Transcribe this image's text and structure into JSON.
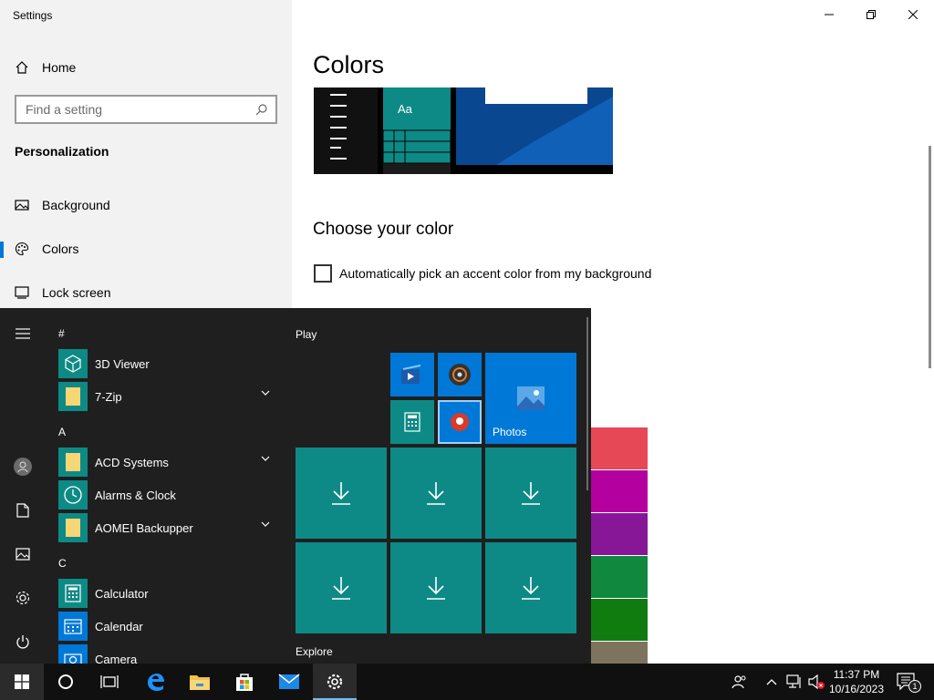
{
  "window": {
    "title": "Settings"
  },
  "sidebar": {
    "home_label": "Home",
    "search_placeholder": "Find a setting",
    "section_title": "Personalization",
    "items": [
      {
        "label": "Background",
        "icon": "image-icon"
      },
      {
        "label": "Colors",
        "icon": "palette-icon",
        "active": true
      },
      {
        "label": "Lock screen",
        "icon": "lock-screen-icon"
      }
    ]
  },
  "main": {
    "title": "Colors",
    "preview_tile_text": "Aa",
    "choose_title": "Choose your color",
    "auto_pick_label": "Automatically pick an accent color from my background",
    "auto_pick_checked": false
  },
  "swatch_colors": [
    "#e74856",
    "#b4009e",
    "#881798",
    "#10893e",
    "#107c10",
    "#7e735f"
  ],
  "start_menu": {
    "sections": [
      {
        "header": "#",
        "apps": [
          {
            "name": "3D Viewer",
            "icon": "cube-icon"
          },
          {
            "name": "7-Zip",
            "icon": "folder-icon",
            "expandable": true
          }
        ]
      },
      {
        "header": "A",
        "apps": [
          {
            "name": "ACD Systems",
            "icon": "folder-icon",
            "expandable": true
          },
          {
            "name": "Alarms & Clock",
            "icon": "clock-icon"
          },
          {
            "name": "AOMEI Backupper",
            "icon": "folder-icon",
            "expandable": true
          }
        ]
      },
      {
        "header": "C",
        "apps": [
          {
            "name": "Calculator",
            "icon": "calculator-icon"
          },
          {
            "name": "Calendar",
            "icon": "calendar-icon"
          },
          {
            "name": "Camera",
            "icon": "camera-icon"
          }
        ]
      }
    ],
    "groups": {
      "play": "Play",
      "explore": "Explore"
    },
    "tiles": {
      "photos_label": "Photos"
    }
  },
  "taskbar": {
    "time": "11:37 PM",
    "date": "10/16/2023",
    "notification_count": "1"
  },
  "colors": {
    "accent": "#0078d7",
    "tile_teal": "#0e8a86",
    "start_bg": "#1f1f1f",
    "taskbar_bg": "#101010"
  }
}
